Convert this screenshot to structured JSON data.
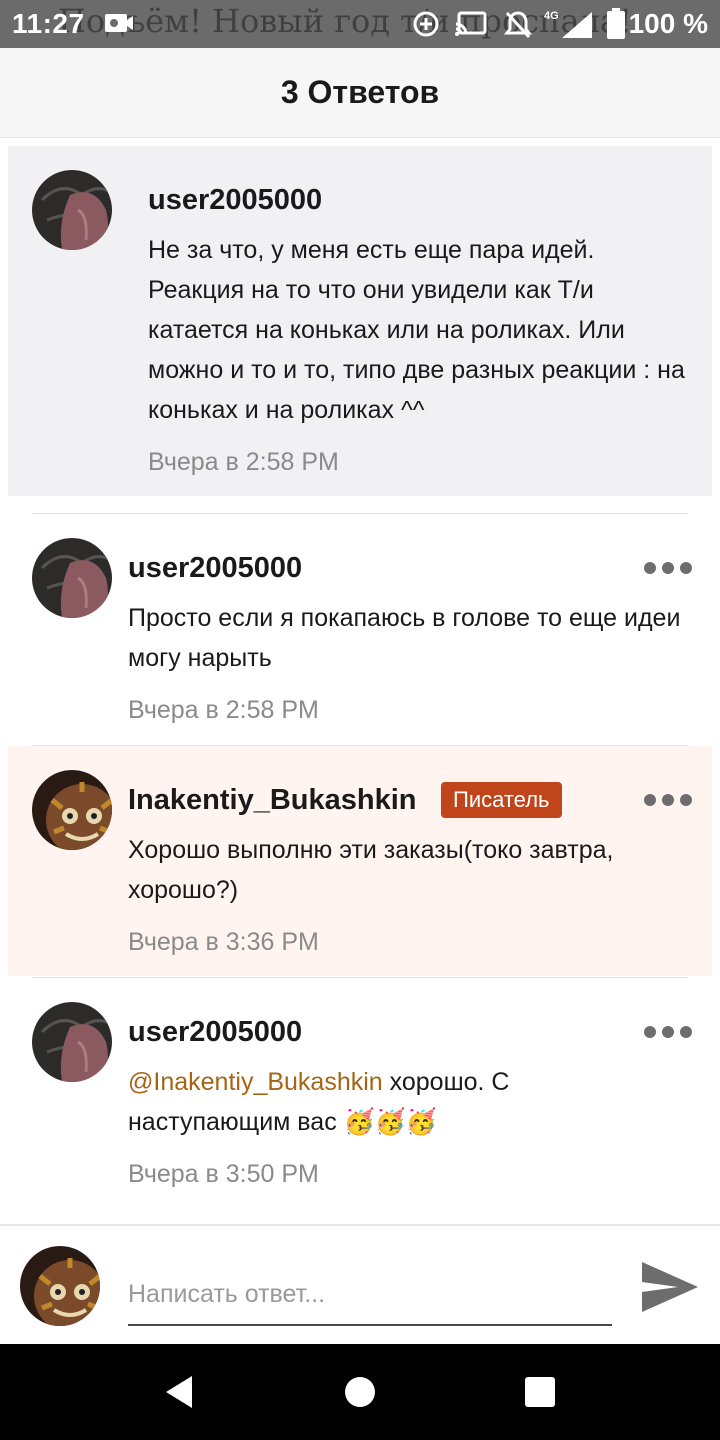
{
  "status_bar": {
    "time": "11:27",
    "battery": "100 %",
    "network": "4G",
    "background_ghost_text": "Подъём! Новый год т/и проспала!"
  },
  "header": {
    "title": "3 Ответов"
  },
  "comments": [
    {
      "user": "user2005000",
      "text": "Не за что, у меня есть еще пара идей. Реакция на то что они увидели как Т/и катается на коньках или на роликах. Или можно и то и то, типо две разных реакции : на коньках и на роликах ^^",
      "time": "Вчера в 2:58 PM"
    },
    {
      "user": "user2005000",
      "text": "Просто если я покапаюсь в голове то еще идеи могу нарыть",
      "time": "Вчера в 2:58 PM"
    },
    {
      "user": "Inakentiy_Bukashkin",
      "badge": "Писатель",
      "text": "Хорошо выполню эти заказы(токо завтра, хорошо?)",
      "time": "Вчера в 3:36 PM"
    },
    {
      "user": "user2005000",
      "mention": "@Inakentiy_Bukashkin",
      "text": " хорошо. С наступающим вас 🥳🥳🥳",
      "time": "Вчера в 3:50 PM"
    }
  ],
  "reply": {
    "placeholder": "Написать ответ..."
  },
  "colors": {
    "badge": "#c0451a",
    "mention": "#a66416",
    "author_highlight": "#fff4f0",
    "parent_bg": "#f1f1f3"
  },
  "icons": [
    "video-record-icon",
    "sync-icon",
    "cast-icon",
    "mute-icon",
    "signal-icon",
    "battery-icon",
    "more-icon",
    "send-icon",
    "back-icon",
    "home-icon",
    "recents-icon"
  ]
}
